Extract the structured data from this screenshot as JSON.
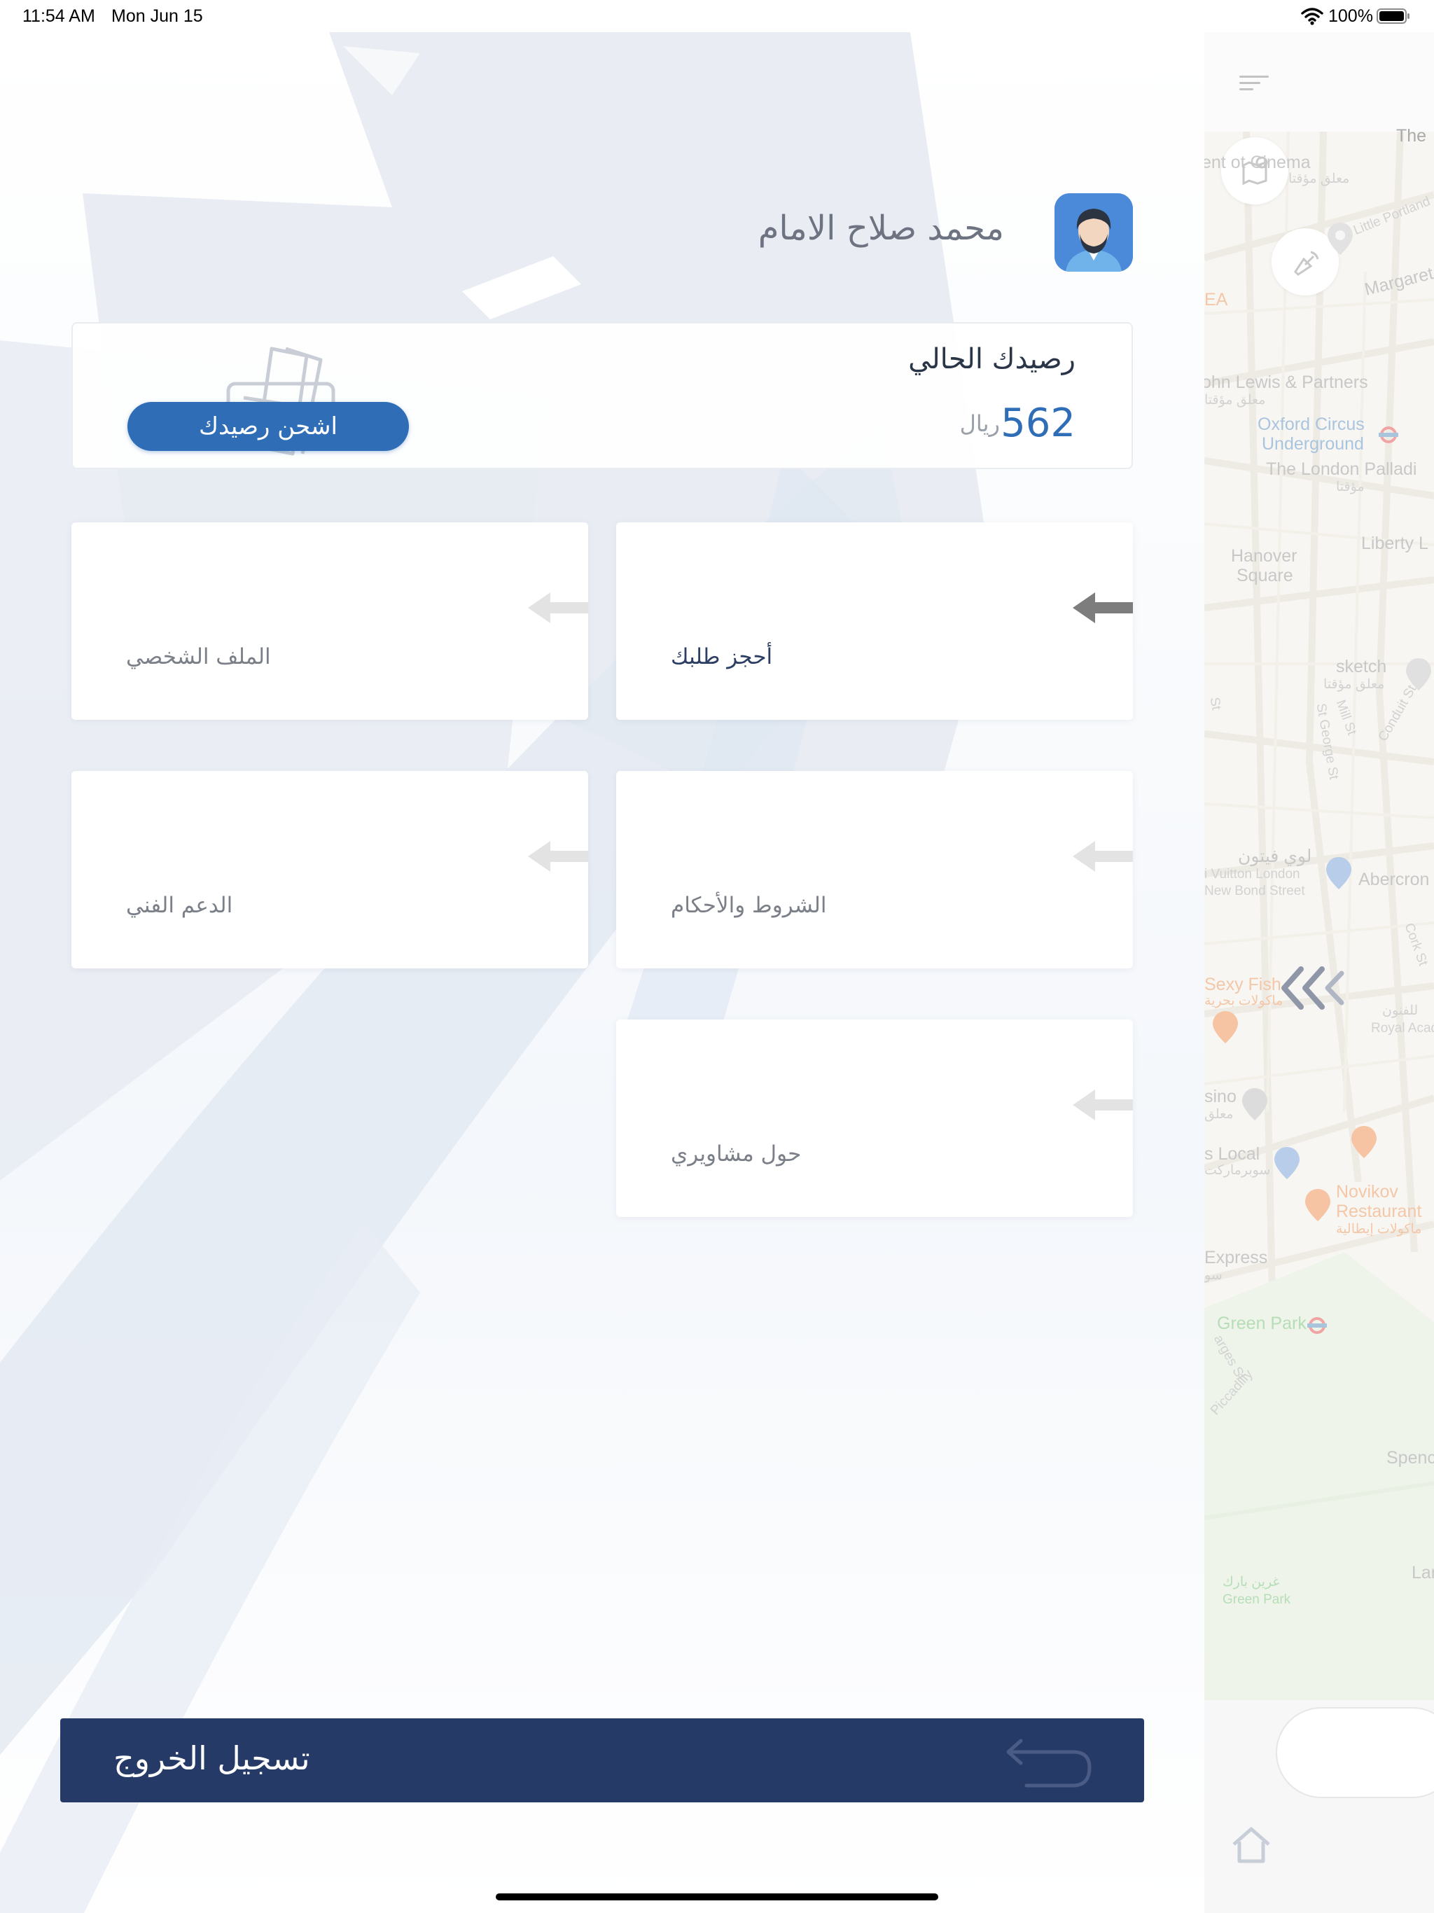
{
  "status_bar": {
    "time": "11:54 AM",
    "date": "Mon Jun 15",
    "battery": "100%"
  },
  "drawer": {
    "user_name": "محمد صلاح الامام",
    "balance": {
      "title": "رصيدك الحالي",
      "amount": "562",
      "currency": "ريال",
      "recharge_label": "اشحن رصيدك"
    },
    "tiles": [
      {
        "label": "أحجز طلبك"
      },
      {
        "label": "الملف الشخصي"
      },
      {
        "label": "الشروط والأحكام"
      },
      {
        "label": "الدعم الفني"
      },
      {
        "label": "حول مشاويري"
      }
    ],
    "logout_label": "تسجيل الخروج"
  },
  "map": {
    "labels": {
      "cinema": "ent   ot Cinema",
      "cinema_sub": "معلق مؤقتا",
      "the": "The",
      "little_portland": "Little Portland",
      "margaret": "Margaret",
      "ea": "EA",
      "john_lewis": "ohn Lewis & Partners",
      "john_lewis_sub": "معلق مؤقتا",
      "oxford_circus": "Oxford Circus",
      "underground": "Underground",
      "palladium": "The London Palladi",
      "palladium_sub": "مؤقتا",
      "liberty": "Liberty L",
      "hanover": "Hanover",
      "square": "Square",
      "sketch": "sketch",
      "sketch_sub": "معلق مؤقتا",
      "st": "St",
      "st_george": "St George St",
      "mill_st": "Mill St",
      "conduit_st": "Conduit St",
      "vuitton_ar": "لوي فيتون",
      "vuitton": "i Vuitton London",
      "new_bond": "New Bond Street",
      "abercorn": "Abercron",
      "cork_st": "Cork St",
      "sexy_fish": "Sexy Fish",
      "sexy_fish_sub": "ماكولات بحرية",
      "royal_ar": "للفنون",
      "royal": "Royal Acade",
      "casino": "sino",
      "casino_sub": "معلق",
      "local": "s Local",
      "local_sub": "سوبرماركت",
      "novikov": "Novikov",
      "novikov_restaurant": "Restaurant",
      "novikov_sub": "ماكولات إيطالية",
      "express": "Express",
      "express_sub": "سو",
      "green_park": "Green Park",
      "piccadilly": "Piccadilly",
      "arges_st": "arges St",
      "spencer": "Spencer",
      "green_park_ar": "غرين بارك",
      "green_park_small": "Green Park",
      "lan": "Lan"
    }
  }
}
